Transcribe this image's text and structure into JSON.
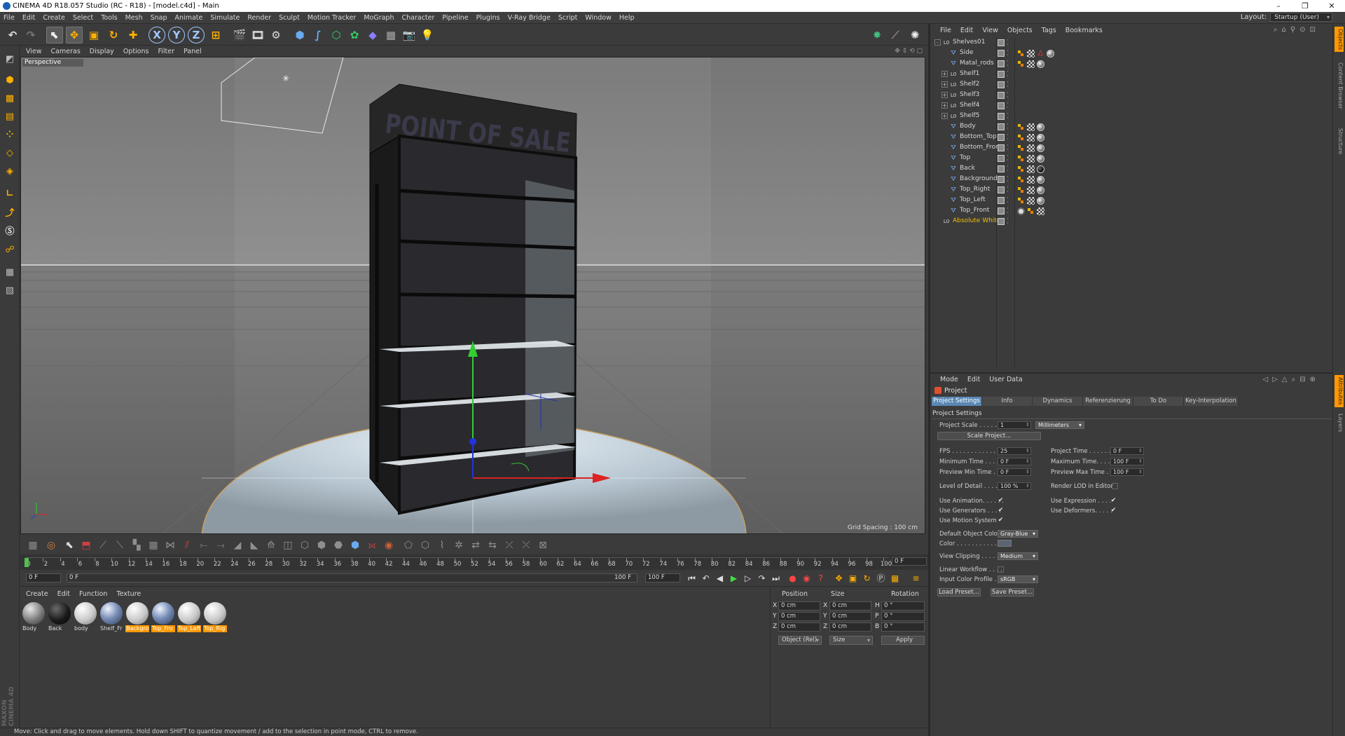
{
  "window": {
    "title": "CINEMA 4D R18.057 Studio (RC - R18) - [model.c4d] - Main"
  },
  "menubar": {
    "items": [
      "File",
      "Edit",
      "Create",
      "Select",
      "Tools",
      "Mesh",
      "Snap",
      "Animate",
      "Simulate",
      "Render",
      "Sculpt",
      "Motion Tracker",
      "MoGraph",
      "Character",
      "Pipeline",
      "Plugins",
      "V-Ray Bridge",
      "Script",
      "Window",
      "Help"
    ],
    "layout_label": "Layout:",
    "layout_value": "Startup (User)"
  },
  "toolbar": {
    "axes": [
      "X",
      "Y",
      "Z"
    ]
  },
  "viewport": {
    "menu": [
      "View",
      "Cameras",
      "Display",
      "Options",
      "Filter",
      "Panel"
    ],
    "label": "Perspective",
    "grid_spacing": "Grid Spacing : 100 cm",
    "sign_text": "POINT OF SALE"
  },
  "timeline": {
    "frames": [
      0,
      2,
      4,
      6,
      8,
      10,
      12,
      14,
      16,
      18,
      20,
      22,
      24,
      26,
      28,
      30,
      32,
      34,
      36,
      38,
      40,
      42,
      44,
      46,
      48,
      50,
      52,
      54,
      56,
      58,
      60,
      62,
      64,
      66,
      68,
      70,
      72,
      74,
      76,
      78,
      80,
      82,
      84,
      86,
      88,
      90,
      92,
      94,
      96,
      98,
      100
    ],
    "end_field": "0 F"
  },
  "playbar": {
    "current": "0 F",
    "start": "0 F",
    "max_label": "100 F",
    "end": "100 F"
  },
  "materials": {
    "menu": [
      "Create",
      "Edit",
      "Function",
      "Texture"
    ],
    "items": [
      {
        "label": "Body",
        "tone": "gray",
        "highlight": false
      },
      {
        "label": "Back",
        "tone": "black",
        "highlight": false
      },
      {
        "label": "body",
        "tone": "white",
        "highlight": false
      },
      {
        "label": "Shelf_Fr",
        "tone": "blue",
        "highlight": false
      },
      {
        "label": "Backgro",
        "tone": "white",
        "highlight": true
      },
      {
        "label": "Top_Fro",
        "tone": "blue",
        "highlight": true
      },
      {
        "label": "Top_Left",
        "tone": "white",
        "highlight": true
      },
      {
        "label": "Top_Rig",
        "tone": "white",
        "highlight": true
      }
    ]
  },
  "coords": {
    "headers": [
      "Position",
      "Size",
      "Rotation"
    ],
    "rows": [
      {
        "axis": "X",
        "pos": "0 cm",
        "saxis": "X",
        "size": "0 cm",
        "raxis": "H",
        "rot": "0 °"
      },
      {
        "axis": "Y",
        "pos": "0 cm",
        "saxis": "Y",
        "size": "0 cm",
        "raxis": "P",
        "rot": "0 °"
      },
      {
        "axis": "Z",
        "pos": "0 cm",
        "saxis": "Z",
        "size": "0 cm",
        "raxis": "B",
        "rot": "0 °"
      }
    ],
    "mode": "Object (Rel)",
    "size_mode": "Size",
    "apply": "Apply"
  },
  "status": "Move: Click and drag to move elements. Hold down SHIFT to quantize movement / add to the selection in point mode, CTRL to remove.",
  "branding": {
    "logo": "MAXON CINEMA 4D"
  },
  "objects": {
    "menu": [
      "File",
      "Edit",
      "View",
      "Objects",
      "Tags",
      "Bookmarks"
    ],
    "rows": [
      {
        "name": "Shelves01",
        "indent": 0,
        "type": "null",
        "expand": "-",
        "tags": []
      },
      {
        "name": "Side",
        "indent": 1,
        "type": "poly",
        "expand": "",
        "tags": [
          "phong",
          "ck",
          "warn",
          "sp"
        ]
      },
      {
        "name": "Matal_rods",
        "indent": 1,
        "type": "poly",
        "expand": "",
        "tags": [
          "phong",
          "ck",
          "sp"
        ]
      },
      {
        "name": "Shelf1",
        "indent": 1,
        "type": "null",
        "expand": "+",
        "tags": []
      },
      {
        "name": "Shelf2",
        "indent": 1,
        "type": "null",
        "expand": "+",
        "tags": []
      },
      {
        "name": "Shelf3",
        "indent": 1,
        "type": "null",
        "expand": "+",
        "tags": []
      },
      {
        "name": "Shelf4",
        "indent": 1,
        "type": "null",
        "expand": "+",
        "tags": []
      },
      {
        "name": "Shelf5",
        "indent": 1,
        "type": "null",
        "expand": "+",
        "tags": []
      },
      {
        "name": "Body",
        "indent": 1,
        "type": "poly",
        "expand": "",
        "tags": [
          "phong",
          "ck",
          "sp"
        ]
      },
      {
        "name": "Bottom_Top",
        "indent": 1,
        "type": "poly",
        "expand": "",
        "tags": [
          "phong",
          "ck",
          "sp"
        ]
      },
      {
        "name": "Bottom_Front",
        "indent": 1,
        "type": "poly",
        "expand": "",
        "tags": [
          "phong",
          "ck",
          "sp"
        ]
      },
      {
        "name": "Top",
        "indent": 1,
        "type": "poly",
        "expand": "",
        "tags": [
          "phong",
          "ck",
          "sp"
        ]
      },
      {
        "name": "Back",
        "indent": 1,
        "type": "poly",
        "expand": "",
        "tags": [
          "phong",
          "ck",
          "spd"
        ]
      },
      {
        "name": "Background",
        "indent": 1,
        "type": "poly",
        "expand": "",
        "tags": [
          "phong",
          "ck",
          "sp"
        ]
      },
      {
        "name": "Top_Right",
        "indent": 1,
        "type": "poly",
        "expand": "",
        "tags": [
          "phong",
          "ck",
          "sp"
        ]
      },
      {
        "name": "Top_Left",
        "indent": 1,
        "type": "poly",
        "expand": "",
        "tags": [
          "phong",
          "ck",
          "sp"
        ]
      },
      {
        "name": "Top_Front",
        "indent": 1,
        "type": "poly",
        "expand": "",
        "tags": [
          "tgt",
          "phong",
          "ck"
        ]
      },
      {
        "name": "Absolute White",
        "indent": 0,
        "type": "null",
        "expand": "",
        "tags": [],
        "highlight": true
      }
    ]
  },
  "sidetabs_top": [
    "Objects",
    "Content Browser",
    "Structure"
  ],
  "sidetabs_bottom": [
    "Attributes",
    "Layers"
  ],
  "attributes": {
    "menu": [
      "Mode",
      "Edit",
      "User Data"
    ],
    "title": "Project",
    "tabs": [
      "Project Settings",
      "Info",
      "Dynamics",
      "Referenzierung",
      "To Do",
      "Key-Interpolation"
    ],
    "section": "Project Settings",
    "project_scale_label": "Project Scale . . . . . .",
    "project_scale_value": "1",
    "project_scale_unit": "Millimeters",
    "scale_project_btn": "Scale Project...",
    "fps_label": "FPS . . . . . . . . . . . . . . .",
    "fps_value": "25",
    "min_time_label": "Minimum Time . . . . .",
    "min_time_value": "0 F",
    "preview_min_label": "Preview Min Time . .",
    "preview_min_value": "0 F",
    "project_time_label": "Project Time . . . . . .",
    "project_time_value": "0 F",
    "max_time_label": "Maximum Time. . . . .",
    "max_time_value": "100 F",
    "preview_max_label": "Preview Max Time . .",
    "preview_max_value": "100 F",
    "lod_label": "Level of Detail . . . . .",
    "lod_value": "100 %",
    "render_lod_label": "Render LOD in Editor",
    "use_anim_label": "Use Animation. . . . . .",
    "use_gen_label": "Use Generators . . . .",
    "use_motion_label": "Use Motion System",
    "use_expr_label": "Use Expression . . . .",
    "use_def_label": "Use Deformers. . . . .",
    "def_obj_color_label": "Default Object Color",
    "def_obj_color_value": "Gray-Blue",
    "color_label": "Color . . . . . . . . . . . .",
    "view_clip_label": "View Clipping . . . . . .",
    "view_clip_value": "Medium",
    "linear_wf_label": "Linear Workflow . . . .",
    "input_cp_label": "Input Color Profile . . .",
    "input_cp_value": "sRGB",
    "load_preset": "Load Preset...",
    "save_preset": "Save Preset..."
  }
}
